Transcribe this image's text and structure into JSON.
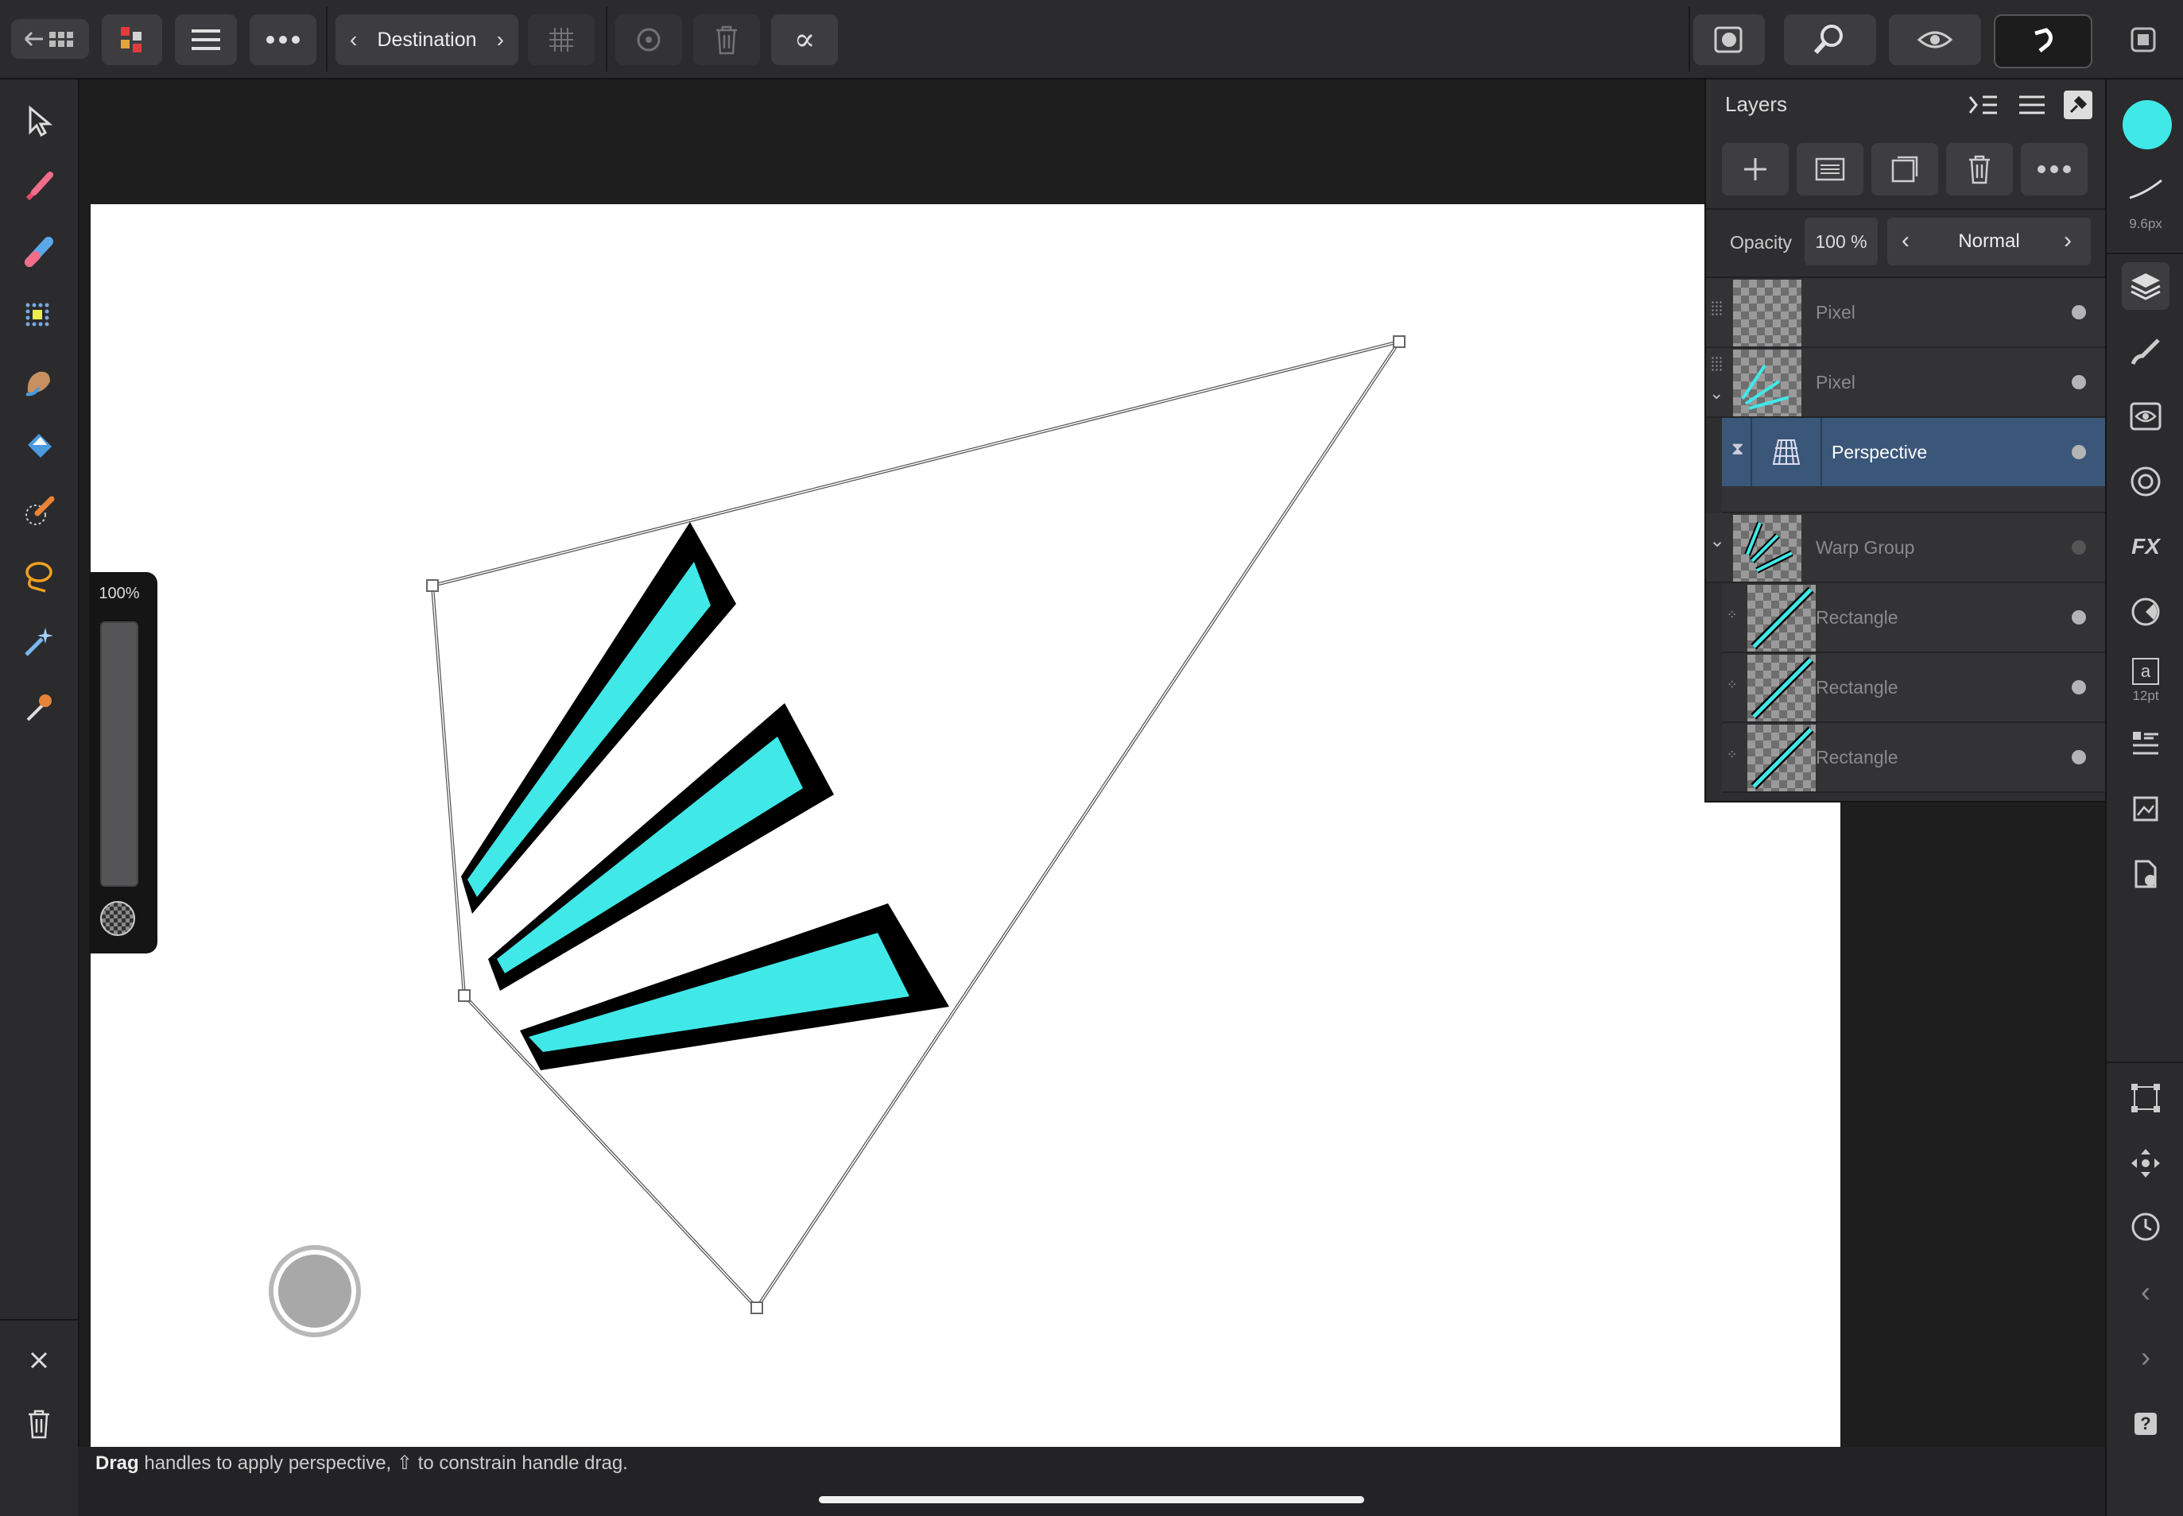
{
  "toolbar": {
    "destination_label": "Destination",
    "alpha_symbol": "∝"
  },
  "zoom": {
    "percent_label": "100%"
  },
  "layers_panel": {
    "title": "Layers",
    "opacity_label": "Opacity",
    "opacity_value": "100 %",
    "blend_mode": "Normal",
    "layers": [
      {
        "name": "Pixel",
        "selected": false
      },
      {
        "name": "Pixel",
        "selected": false
      },
      {
        "name": "Perspective",
        "selected": true
      },
      {
        "name": "Warp Group",
        "selected": false
      },
      {
        "name": "Rectangle",
        "selected": false
      },
      {
        "name": "Rectangle",
        "selected": false
      },
      {
        "name": "Rectangle",
        "selected": false
      }
    ]
  },
  "right_strip": {
    "brush_size_label": "9.6px",
    "text_size_label": "12pt",
    "text_icon_letter": "a",
    "fx_label": "FX",
    "help_label": "?"
  },
  "status": {
    "hint_bold": "Drag",
    "hint_rest": "handles to apply perspective, ⇧ to constrain handle drag."
  },
  "colors": {
    "accent_cyan": "#40e8e8",
    "selected_layer": "#3a5679",
    "canvas": "#ffffff",
    "ui_background": "#2b2b2d"
  }
}
